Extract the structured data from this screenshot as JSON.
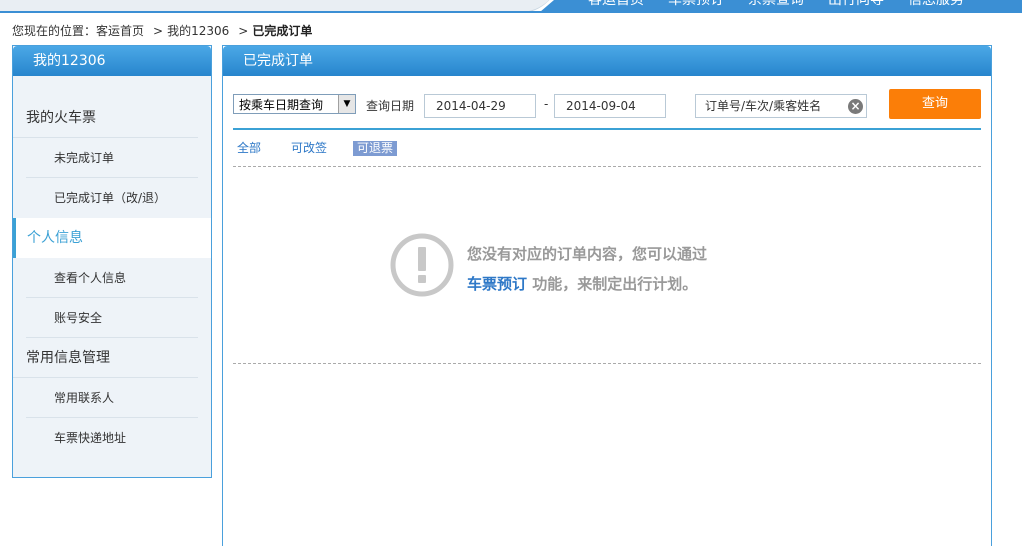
{
  "topnav": {
    "items": [
      "客运首页",
      "车票预订",
      "余票查询",
      "出行向导",
      "信息服务"
    ]
  },
  "breadcrumb": {
    "prefix": "您现在的位置：",
    "home": "客运首页",
    "sep1": ">",
    "mine": "我的12306",
    "sep2": ">",
    "current": "已完成订单"
  },
  "sidebar": {
    "title": "我的12306",
    "groups": [
      {
        "title": "我的火车票",
        "items": [
          "未完成订单",
          "已完成订单（改/退）"
        ]
      },
      {
        "title": "个人信息",
        "items": [
          "查看个人信息",
          "账号安全"
        ]
      },
      {
        "title": "常用信息管理",
        "items": [
          "常用联系人",
          "车票快递地址"
        ]
      }
    ]
  },
  "main": {
    "title": "已完成订单",
    "query": {
      "select_value": "按乘车日期查询",
      "date_label": "查询日期",
      "date_from": "2014-04-29",
      "date_sep": "-",
      "date_to": "2014-09-04",
      "search_placeholder": "订单号/车次/乘客姓名",
      "button_label": "查询"
    },
    "tabs": [
      "全部",
      "可改签",
      "可退票"
    ],
    "active_tab": "可退票",
    "empty": {
      "line1": "您没有对应的订单内容，您可以通过",
      "link": "车票预订",
      "line2_rest": "功能，来制定出行计划。"
    }
  },
  "colors": {
    "header_blue": "#2785cd",
    "accent_blue": "#3ba1d5",
    "button_orange": "#fb7e08",
    "active_tab_bg": "#7d9bd2"
  }
}
